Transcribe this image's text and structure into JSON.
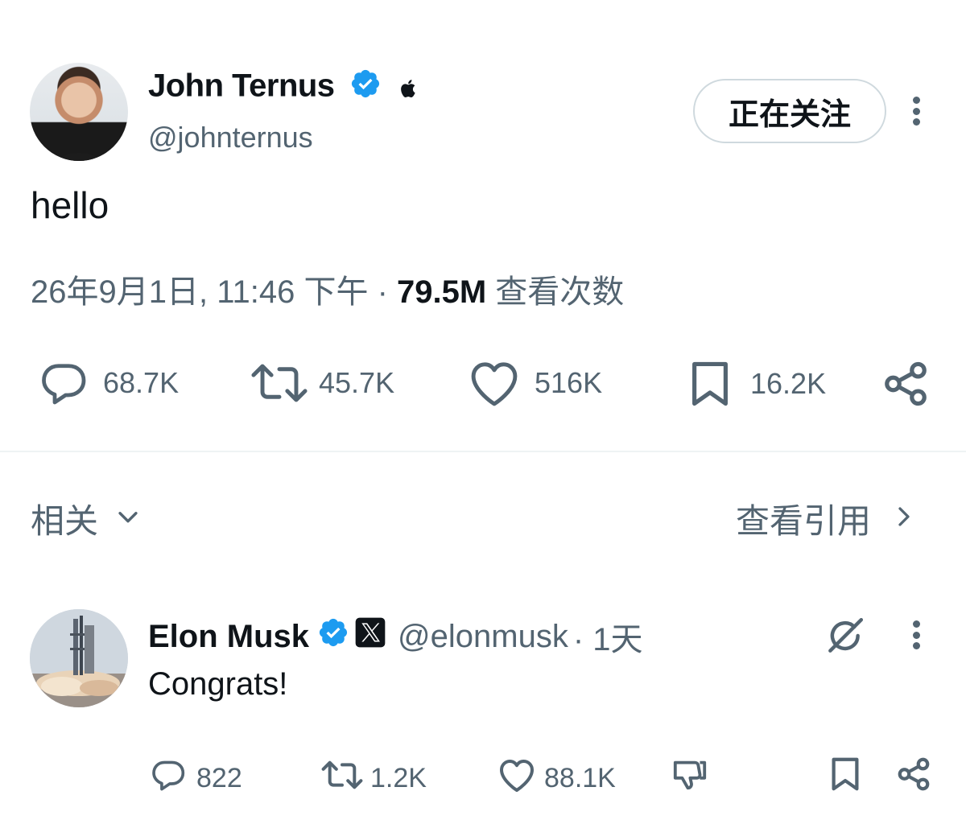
{
  "tweet": {
    "author_name": "John Ternus",
    "author_handle": "@johnternus",
    "follow_label": "正在关注",
    "text": "hello",
    "timestamp": "26年9月1日, 11:46 下午",
    "separator": " · ",
    "views_count": "79.5M",
    "views_label": " 查看次数",
    "stats": {
      "replies": "68.7K",
      "retweets": "45.7K",
      "likes": "516K",
      "bookmarks": "16.2K"
    }
  },
  "related": {
    "label": "相关",
    "view_quotes": "查看引用"
  },
  "reply": {
    "author_name": "Elon Musk",
    "author_handle": "@elonmusk",
    "time": "· 1天",
    "text": "Congrats!",
    "stats": {
      "replies": "822",
      "retweets": "1.2K",
      "likes": "88.1K"
    }
  },
  "colors": {
    "verified": "#1d9bf0",
    "secondary_text": "#536471",
    "divider": "#eff3f4"
  },
  "icons": [
    "verified-icon",
    "apple-icon",
    "more-icon",
    "reply-icon",
    "retweet-icon",
    "like-icon",
    "bookmark-icon",
    "share-icon",
    "chevron-down-icon",
    "chevron-right-icon",
    "x-logo-icon",
    "grok-icon",
    "dislike-icon"
  ]
}
